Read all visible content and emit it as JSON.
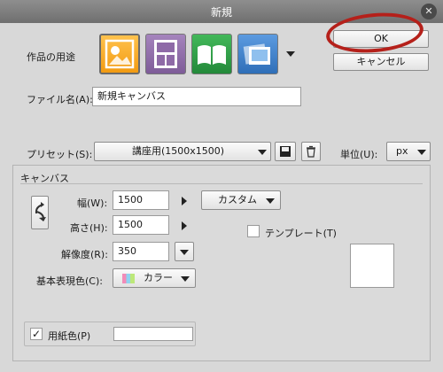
{
  "window": {
    "title": "新規"
  },
  "header": {
    "usage_label": "作品の用途",
    "usage_icons": [
      "illustration-icon",
      "comic-icon",
      "book-icon",
      "animation-icon"
    ],
    "ok_label": "OK",
    "cancel_label": "キャンセル"
  },
  "filename": {
    "label": "ファイル名(A):",
    "value": "新規キャンバス"
  },
  "preset": {
    "label": "プリセット(S):",
    "value": "講座用(1500x1500)",
    "unit_label": "単位(U):",
    "unit_value": "px"
  },
  "canvas": {
    "section_title": "キャンバス",
    "width_label": "幅(W):",
    "width_value": "1500",
    "height_label": "高さ(H):",
    "height_value": "1500",
    "size_preset_value": "カスタム",
    "template_label": "テンプレート(T)",
    "resolution_label": "解像度(R):",
    "resolution_value": "350",
    "color_label": "基本表現色(C):",
    "color_value": "カラー",
    "paper_color_label": "用紙色(P)",
    "paper_color_checked": true
  },
  "colors": {
    "annotation": "#b5201a",
    "selected_tile": "#f4a623",
    "comic_tile": "#8e6aa7",
    "book_tile": "#2f9e46",
    "animation_tile": "#3c7fc8"
  }
}
